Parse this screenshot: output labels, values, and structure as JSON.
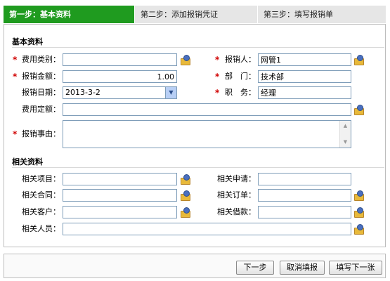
{
  "steps": [
    {
      "label": "第一步：基本资料",
      "active": true
    },
    {
      "label": "第二步：添加报销凭证",
      "active": false
    },
    {
      "label": "第三步：填写报销单",
      "active": false
    }
  ],
  "basic": {
    "title": "基本资料",
    "fee_type": {
      "label": "费用类别：",
      "value": ""
    },
    "claimant": {
      "label": "报销人：",
      "value": "网管1"
    },
    "amount": {
      "label": "报销金额：",
      "value": "1.00"
    },
    "department": {
      "label": "部　门：",
      "value": "技术部"
    },
    "date": {
      "label": "报销日期：",
      "value": "2013-3-2"
    },
    "position": {
      "label": "职　务：",
      "value": "经理"
    },
    "quota": {
      "label": "费用定额：",
      "value": ""
    },
    "reason": {
      "label": "报销事由：",
      "value": ""
    }
  },
  "related": {
    "title": "相关资料",
    "project": {
      "label": "相关项目：",
      "value": ""
    },
    "request": {
      "label": "相关申请：",
      "value": ""
    },
    "contract": {
      "label": "相关合同：",
      "value": ""
    },
    "order": {
      "label": "相关订单：",
      "value": ""
    },
    "customer": {
      "label": "相关客户：",
      "value": ""
    },
    "loan": {
      "label": "相关借款：",
      "value": ""
    },
    "person": {
      "label": "相关人员：",
      "value": ""
    }
  },
  "required_mark": "*",
  "buttons": {
    "next": "下一步",
    "cancel": "取消填报",
    "next_sheet": "填写下一张"
  },
  "colors": {
    "active_step": "#1f9b1f",
    "required": "#d00000"
  },
  "icons": {
    "lookup": "lookup-folder-person-icon",
    "dropdown": "chevron-down-icon"
  }
}
